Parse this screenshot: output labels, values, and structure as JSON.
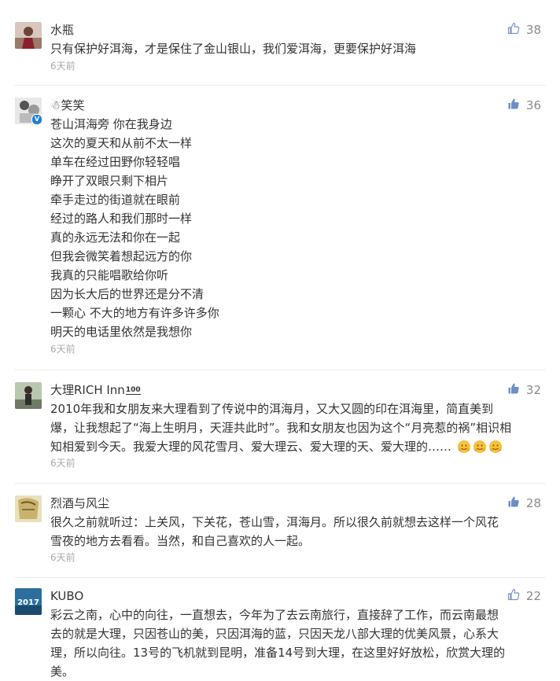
{
  "comments": [
    {
      "user": "水瓶",
      "likes": "38",
      "lines": [
        "只有保护好洱海，才是保住了金山银山，我们爱洱海，更要保护好洱海"
      ],
      "time": "6天前"
    },
    {
      "user": "☃笑笑",
      "likes": "36",
      "verified": "V",
      "lines": [
        "苍山洱海旁 你在我身边",
        "这次的夏天和从前不太一样",
        "单车在经过田野你轻轻唱",
        "睁开了双眼只剩下相片",
        "牵手走过的街道就在眼前",
        "经过的路人和我们那时一样",
        "真的永远无法和你在一起",
        "但我会微笑着想起远方的你",
        "我真的只能唱歌给你听",
        "因为长大后的世界还是分不清",
        "一颗心 不大的地方有许多许多你",
        "明天的电话里依然是我想你"
      ],
      "time": "6天前"
    },
    {
      "user": "大理RICH Inn",
      "user_tag": "100",
      "likes": "32",
      "lines": [
        "2010年我和女朋友来大理看到了传说中的洱海月，又大又圆的印在洱海里，简直美到",
        "爆，让我想起了“海上生明月，天涯共此时”。我和女朋友也因为这个“月亮惹的祸”相识相",
        "知相爱到今天。我爱大理的风花雪月、爱大理云、爱大理的天、爱大理的……"
      ],
      "time": "6天前"
    },
    {
      "user": "烈酒与风尘",
      "likes": "28",
      "lines": [
        "很久之前就听过：上关风，下关花，苍山雪，洱海月。所以很久前就想去这样一个风花",
        "雪夜的地方去看看。当然，和自己喜欢的人一起。"
      ],
      "time": "6天前"
    },
    {
      "user": "KUBO",
      "likes": "22",
      "lines": [
        "彩云之南，心中的向往，一直想去，今年为了去云南旅行，直接辞了工作，而云南最想",
        "去的就是大理，只因苍山的美，只因洱海的蓝，只因天龙八部大理的优美风景，心系大",
        "理，所以向往。13号的飞机就到昆明，准备14号到大理，在这里好好放松，欣赏大理的",
        "美。"
      ],
      "avatar_text": "2017"
    }
  ],
  "colors": {
    "text": "#333333",
    "muted": "#aaaaaa",
    "like": "#8a8a8a",
    "like_icon_active": "#6e8fc4",
    "verified": "#1a7fd6"
  },
  "icons": {
    "like": "thumbs-up-icon",
    "emoji": "hug-emoji-icon"
  }
}
